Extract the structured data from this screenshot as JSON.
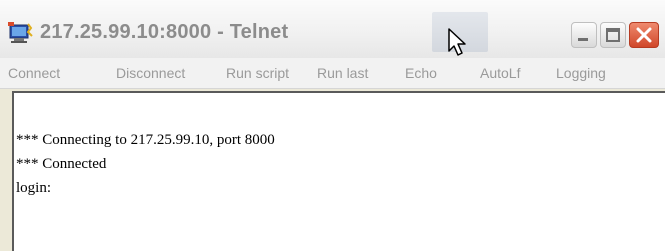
{
  "window": {
    "title": "217.25.99.10:8000 - Telnet"
  },
  "icons": {
    "app": "telnet-app-icon",
    "minimize": "minimize-icon",
    "maximize": "maximize-icon",
    "close": "close-icon",
    "cursor": "mouse-cursor-icon"
  },
  "colors": {
    "close_button": "#d0472a",
    "menu_text": "#9a9a9a",
    "title_text": "#8c8c8c"
  },
  "menu": {
    "items": [
      {
        "label": "Connect"
      },
      {
        "label": "Disconnect"
      },
      {
        "label": "Run script"
      },
      {
        "label": "Run last"
      },
      {
        "label": "Echo"
      },
      {
        "label": "AutoLf"
      },
      {
        "label": "Logging"
      }
    ]
  },
  "terminal": {
    "lines": [
      "*** Connecting to 217.25.99.10, port 8000",
      "*** Connected",
      "login:"
    ]
  }
}
